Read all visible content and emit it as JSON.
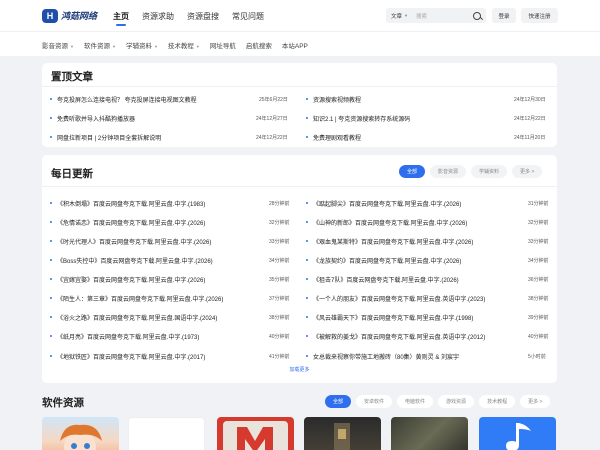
{
  "header": {
    "logo_text": "鸿菇网络",
    "logo_mark": "H",
    "nav": [
      "主页",
      "资源求助",
      "资源盘搜",
      "常见问题"
    ],
    "search": {
      "scope": "文章",
      "placeholder": "搜索"
    },
    "login_label": "登录",
    "register_label": "快速注册"
  },
  "subnav": [
    "影音资源",
    "软件资源",
    "学辅资料",
    "技术教程",
    "网址导航",
    "启航搜索",
    "本站APP"
  ],
  "pinned": {
    "title": "置顶文章",
    "items": [
      {
        "title": "夸克投屏怎么连接电视？ 夸克投屏连接电视图文教程",
        "date": "25年6月22日"
      },
      {
        "title": "资源搜索视频教程",
        "date": "24年12月30日"
      },
      {
        "title": "免费听歌并导入抖酷狗播放器",
        "date": "24年12月27日"
      },
      {
        "title": "知识2.1 | 夸克资源搜索转存系统源码",
        "date": "24年12月22日"
      },
      {
        "title": "网盘拉新项目 | 2分钟项目全套拆解说明",
        "date": "24年12月22日"
      },
      {
        "title": "免费理剧观看教程",
        "date": "24年11月20日"
      }
    ]
  },
  "daily": {
    "title": "每日更新",
    "tabs": [
      "全部",
      "影音资源",
      "学辅资料",
      "更多 >"
    ],
    "left": [
      {
        "title": "《积木倒塌》百度云网盘夸克下载.阿里云盘.中字.(1983)",
        "time": "28分钟前"
      },
      {
        "title": "《危情诺恋》百度云网盘夸克下载.阿里云盘.中字.(2026)",
        "time": "32分钟前"
      },
      {
        "title": "《时光代理人》百度云网盘夸克下载.阿里云盘.中字.(2026)",
        "time": "33分钟前"
      },
      {
        "title": "《Boss失控中》百度云网盘夸克下载.阿里云盘.中字.(2026)",
        "time": "34分钟前"
      },
      {
        "title": "《宜嫁宜娶》百度云网盘夸克下载.阿里云盘.中字.(2026)",
        "time": "35分钟前"
      },
      {
        "title": "《陌生人：第三章》百度云网盘夸克下载.阿里云盘.中字.(2026)",
        "time": "37分钟前"
      },
      {
        "title": "《浴火之路》百度云网盘夸克下载.阿里云盘.国语中字.(2024)",
        "time": "38分钟前"
      },
      {
        "title": "《纸月亮》百度云网盘夸克下载.阿里云盘.中字.(1973)",
        "time": "40分钟前"
      },
      {
        "title": "《地狱铁匠》百度云网盘夸克下载.阿里云盘.中字.(2017)",
        "time": "41分钟前"
      }
    ],
    "right": [
      {
        "title": "《踮起脚尖》百度云网盘夸克下载.阿里云盘.中字.(2026)",
        "time": "31分钟前"
      },
      {
        "title": "《山神的新郎》百度云网盘夸克下载.阿里云盘.中字.(2026)",
        "time": "32分钟前"
      },
      {
        "title": "《艰血鬼某斯特》百度云网盘夸克下载.阿里云盘.中字.(2026)",
        "time": "33分钟前"
      },
      {
        "title": "《龙族契约》百度云网盘夸克下载.阿里云盘.中字.(2026)",
        "time": "34分钟前"
      },
      {
        "title": "《狙击7队》百度云网盘夸克下载.阿里云盘.中字.(2026)",
        "time": "36分钟前"
      },
      {
        "title": "《一个人的朋友》百度云网盘夸克下载.阿里云盘.英语中字.(2023)",
        "time": "38分钟前"
      },
      {
        "title": "《风云雄霸天下》百度云网盘夸克下载.阿里云盘.中字.(1998)",
        "time": "39分钟前"
      },
      {
        "title": "《被解救的姜戈》百度云网盘夸克下载.阿里云盘.英语中字.(2012)",
        "time": "40分钟前"
      },
      {
        "title": "女总裁来视察你带施工地搬砖（80集）黄则灵 & 刘宸宇",
        "time": "5小时前"
      }
    ],
    "load_more": "加载更多"
  },
  "software": {
    "title": "软件资源",
    "tabs": [
      "全部",
      "安卓软件",
      "电脑软件",
      "游戏资源",
      "技术教程",
      "更多 >"
    ],
    "thumbs": [
      "anime-avatar-thumb",
      "blank-thumb",
      "red-m-logo-thumb",
      "dark-game-thumb",
      "dark-scene-thumb",
      "blue-music-thumb"
    ]
  },
  "colors": {
    "accent": "#2f6fed",
    "brand": "#1f4fa8"
  }
}
